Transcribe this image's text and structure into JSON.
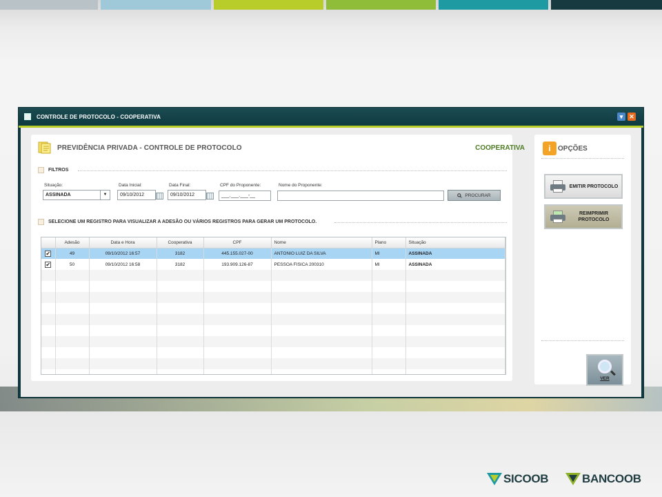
{
  "window": {
    "title": "CONTROLE DE PROTOCOLO - COOPERATIVA",
    "min_glyph": "▾",
    "close_glyph": "✕"
  },
  "main": {
    "title": "PREVIDÊNCIA PRIVADA - CONTROLE DE PROTOCOLO",
    "context": "COOPERATIVA",
    "filters": {
      "header": "FILTROS",
      "situacao_label": "Situação:",
      "situacao_value": "ASSINADA",
      "data_inicial_label": "Data Inicial:",
      "data_inicial_value": "09/10/2012",
      "data_final_label": "Data Final:",
      "data_final_value": "09/10/2012",
      "cpf_label": "CPF do Proponente:",
      "cpf_value": "___.___.___-__",
      "nome_label": "Nome do Proponente:",
      "nome_value": "",
      "search_button": "PROCURAR"
    },
    "grid_header": "SELECIONE UM REGISTRO PARA VISUALIZAR A ADESÃO OU VÁRIOS REGISTROS PARA GERAR UM PROTOCOLO.",
    "grid": {
      "columns": [
        "",
        "Adesão",
        "Data e Hora",
        "Cooperativa",
        "CPF",
        "Nome",
        "Plano",
        "Situação"
      ],
      "rows": [
        {
          "checked": "✔",
          "adesao": "49",
          "data_hora": "09/10/2012 16:57",
          "cooperativa": "3182",
          "cpf": "445.155.027-00",
          "nome": "ANTONIO LUIZ DA SILVA",
          "plano": "MI",
          "situacao": "ASSINADA"
        },
        {
          "checked": "✔",
          "adesao": "50",
          "data_hora": "09/10/2012 16:58",
          "cooperativa": "3182",
          "cpf": "193.909.126-87",
          "nome": "PESSOA FISICA 200310",
          "plano": "MI",
          "situacao": "ASSINADA"
        }
      ]
    }
  },
  "side": {
    "title": "OPÇÕES",
    "info_glyph": "i",
    "emitir": "EMITIR PROTOCOLO",
    "reimprimir": "REIMPRIMIR PROTOCOLO",
    "ver": "VER"
  },
  "brands": {
    "left": "SICOOB",
    "right": "BANCOOB"
  },
  "colors": {
    "accent_green": "#b8cd2a",
    "window_dark": "#0e3a40",
    "selected_row": "#a9d5f5",
    "brand_green": "#8fb22a",
    "brand_teal": "#1f3c41"
  }
}
